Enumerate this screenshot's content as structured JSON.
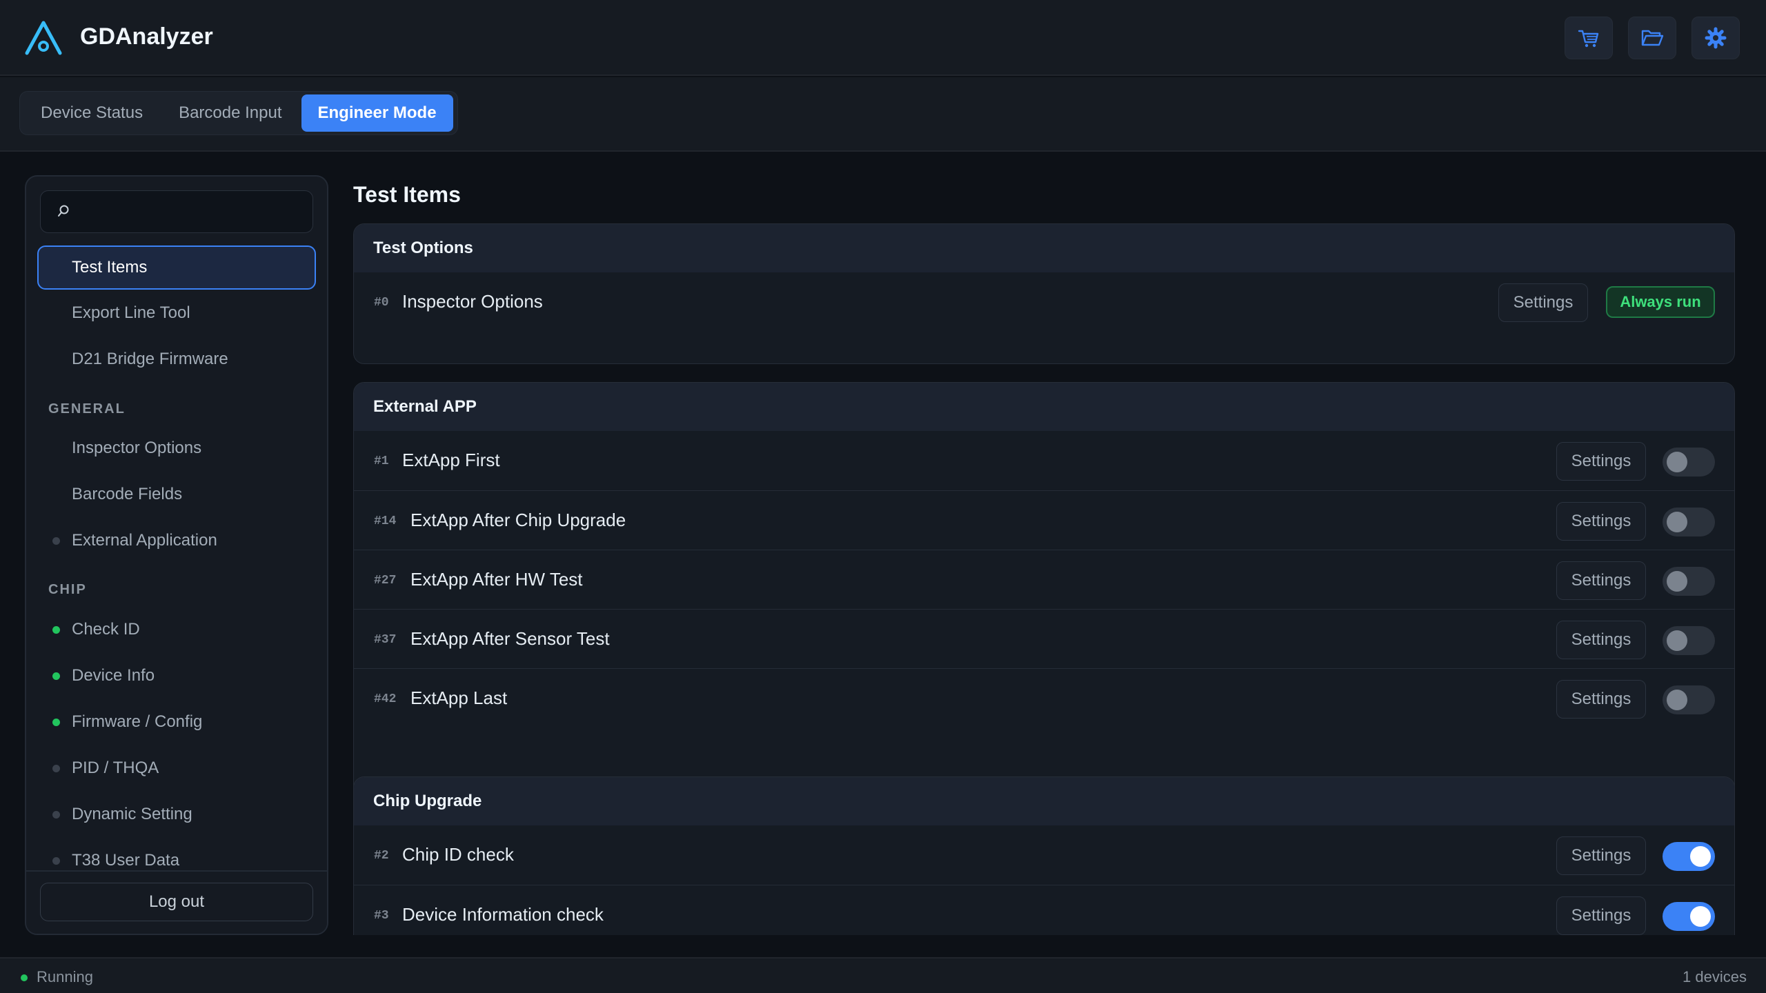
{
  "app": {
    "title": "GDAnalyzer",
    "accent_color": "#3b82f6",
    "header_icons": [
      "cart-icon",
      "folder-icon",
      "gear-icon"
    ]
  },
  "tabs": [
    {
      "label": "Device Status",
      "active": false
    },
    {
      "label": "Barcode Input",
      "active": false
    },
    {
      "label": "Engineer Mode",
      "active": true
    }
  ],
  "sidebar": {
    "search": {
      "value": "",
      "placeholder": ""
    },
    "top_items": [
      {
        "label": "Test Items",
        "active": true
      },
      {
        "label": "Export Line Tool"
      },
      {
        "label": "D21 Bridge Firmware"
      }
    ],
    "sections": [
      {
        "title": "GENERAL",
        "items": [
          {
            "label": "Inspector Options",
            "dot": "none"
          },
          {
            "label": "Barcode Fields",
            "dot": "none"
          },
          {
            "label": "External Application",
            "dot": "grey"
          }
        ]
      },
      {
        "title": "CHIP",
        "items": [
          {
            "label": "Check ID",
            "dot": "green"
          },
          {
            "label": "Device Info",
            "dot": "green"
          },
          {
            "label": "Firmware / Config",
            "dot": "green"
          },
          {
            "label": "PID / THQA",
            "dot": "grey"
          },
          {
            "label": "Dynamic Setting",
            "dot": "grey"
          },
          {
            "label": "T38 User Data",
            "dot": "grey"
          }
        ]
      }
    ],
    "logout_label": "Log out"
  },
  "main": {
    "title": "Test Items",
    "settings_label": "Settings",
    "groups": [
      {
        "title": "Test Options",
        "items": [
          {
            "num": "#0",
            "label": "Inspector Options",
            "badge": "Always run"
          }
        ]
      },
      {
        "title": "External APP",
        "items": [
          {
            "num": "#1",
            "label": "ExtApp First",
            "enabled": false
          },
          {
            "num": "#14",
            "label": "ExtApp After Chip Upgrade",
            "enabled": false
          },
          {
            "num": "#27",
            "label": "ExtApp After HW Test",
            "enabled": false
          },
          {
            "num": "#37",
            "label": "ExtApp After Sensor Test",
            "enabled": false
          },
          {
            "num": "#42",
            "label": "ExtApp Last",
            "enabled": false
          }
        ]
      },
      {
        "title": "Chip Upgrade",
        "items": [
          {
            "num": "#2",
            "label": "Chip ID check",
            "enabled": true
          },
          {
            "num": "#3",
            "label": "Device Information check",
            "enabled": true
          }
        ]
      }
    ]
  },
  "status": {
    "text": "Running",
    "devices": "1 devices"
  }
}
